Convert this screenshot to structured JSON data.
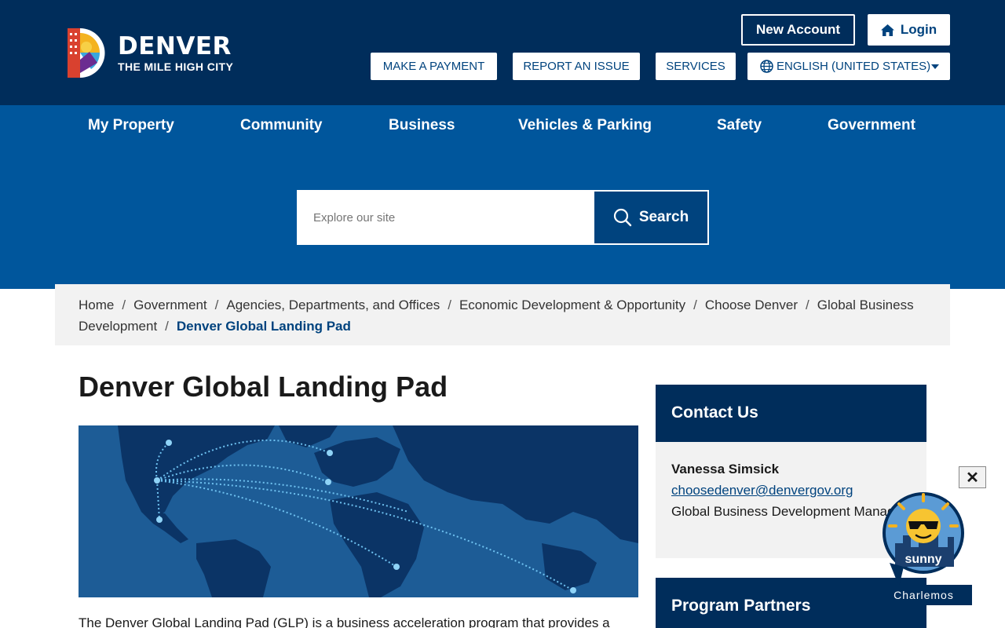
{
  "header": {
    "logo_title": "DENVER",
    "logo_subtitle": "THE MILE HIGH CITY",
    "new_account": "New Account",
    "login": "Login",
    "utility": {
      "payment": "MAKE A PAYMENT",
      "report": "REPORT AN ISSUE",
      "services": "SERVICES",
      "language": "ENGLISH (UNITED STATES)"
    }
  },
  "nav": {
    "items": [
      "My Property",
      "Community",
      "Business",
      "Vehicles & Parking",
      "Safety",
      "Government"
    ]
  },
  "search": {
    "placeholder": "Explore our site",
    "button": "Search"
  },
  "breadcrumb": {
    "items": [
      "Home",
      "Government",
      "Agencies, Departments, and Offices",
      "Economic Development & Opportunity",
      "Choose Denver",
      "Global Business Development"
    ],
    "current": "Denver Global Landing Pad",
    "separator": "/"
  },
  "main": {
    "title": "Denver Global Landing Pad",
    "intro": "The Denver Global Landing Pad (GLP) is a business acceleration program that provides a"
  },
  "sidebar": {
    "contact": {
      "heading": "Contact Us",
      "name": "Vanessa Simsick",
      "email": "choosedenver@denvergov.org",
      "role": "Global Business Development Manager"
    },
    "partners": {
      "heading": "Program Partners"
    }
  },
  "chat": {
    "close": "✕",
    "weather": "sunny",
    "label": "Charlemos"
  },
  "colors": {
    "dark_navy": "#002d5b",
    "nav_blue": "#00569c",
    "button_blue": "#00437e",
    "light_gray": "#f2f2f2"
  }
}
